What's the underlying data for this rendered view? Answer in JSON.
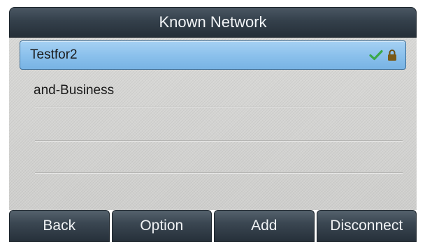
{
  "title": "Known Network",
  "networks": [
    {
      "name": "Testfor2",
      "selected": true,
      "connected": true,
      "secured": true
    },
    {
      "name": "and-Business",
      "selected": false,
      "connected": false,
      "secured": false
    }
  ],
  "softkeys": {
    "back": "Back",
    "option": "Option",
    "add": "Add",
    "disconnect": "Disconnect"
  },
  "colors": {
    "selection": "#8cc1ec",
    "check": "#3aa84a",
    "titlebar": "#34404b"
  },
  "icons": {
    "connected": "checkmark-icon",
    "secured": "lock-icon"
  }
}
